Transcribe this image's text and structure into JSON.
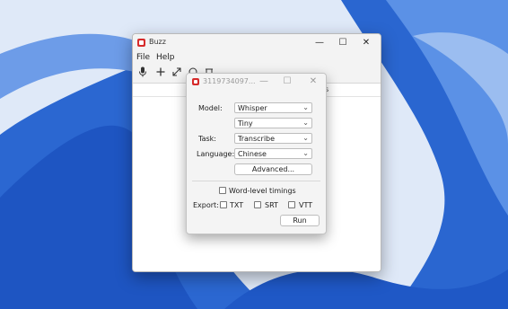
{
  "main_window": {
    "title": "Buzz",
    "menu": [
      "File",
      "Help"
    ],
    "controls": {
      "minimize": "—",
      "maximize": "☐",
      "close": "✕"
    },
    "table_header_partial": "s"
  },
  "dialog": {
    "title": "3119734097...",
    "controls": {
      "minimize": "—",
      "maximize": "☐",
      "close": "✕"
    },
    "model_label": "Model:",
    "model_value": "Whisper",
    "model_size_value": "Tiny",
    "task_label": "Task:",
    "task_value": "Transcribe",
    "language_label": "Language:",
    "language_value": "Chinese",
    "advanced_label": "Advanced...",
    "word_timings_label": "Word-level timings",
    "export_label": "Export:",
    "export_txt": "TXT",
    "export_srt": "SRT",
    "export_vtt": "VTT",
    "run_label": "Run"
  },
  "colors": {
    "accent": "#d62b2b",
    "wallpaper_blue": "#2f6fd4",
    "wallpaper_light": "#dfe9f8"
  }
}
